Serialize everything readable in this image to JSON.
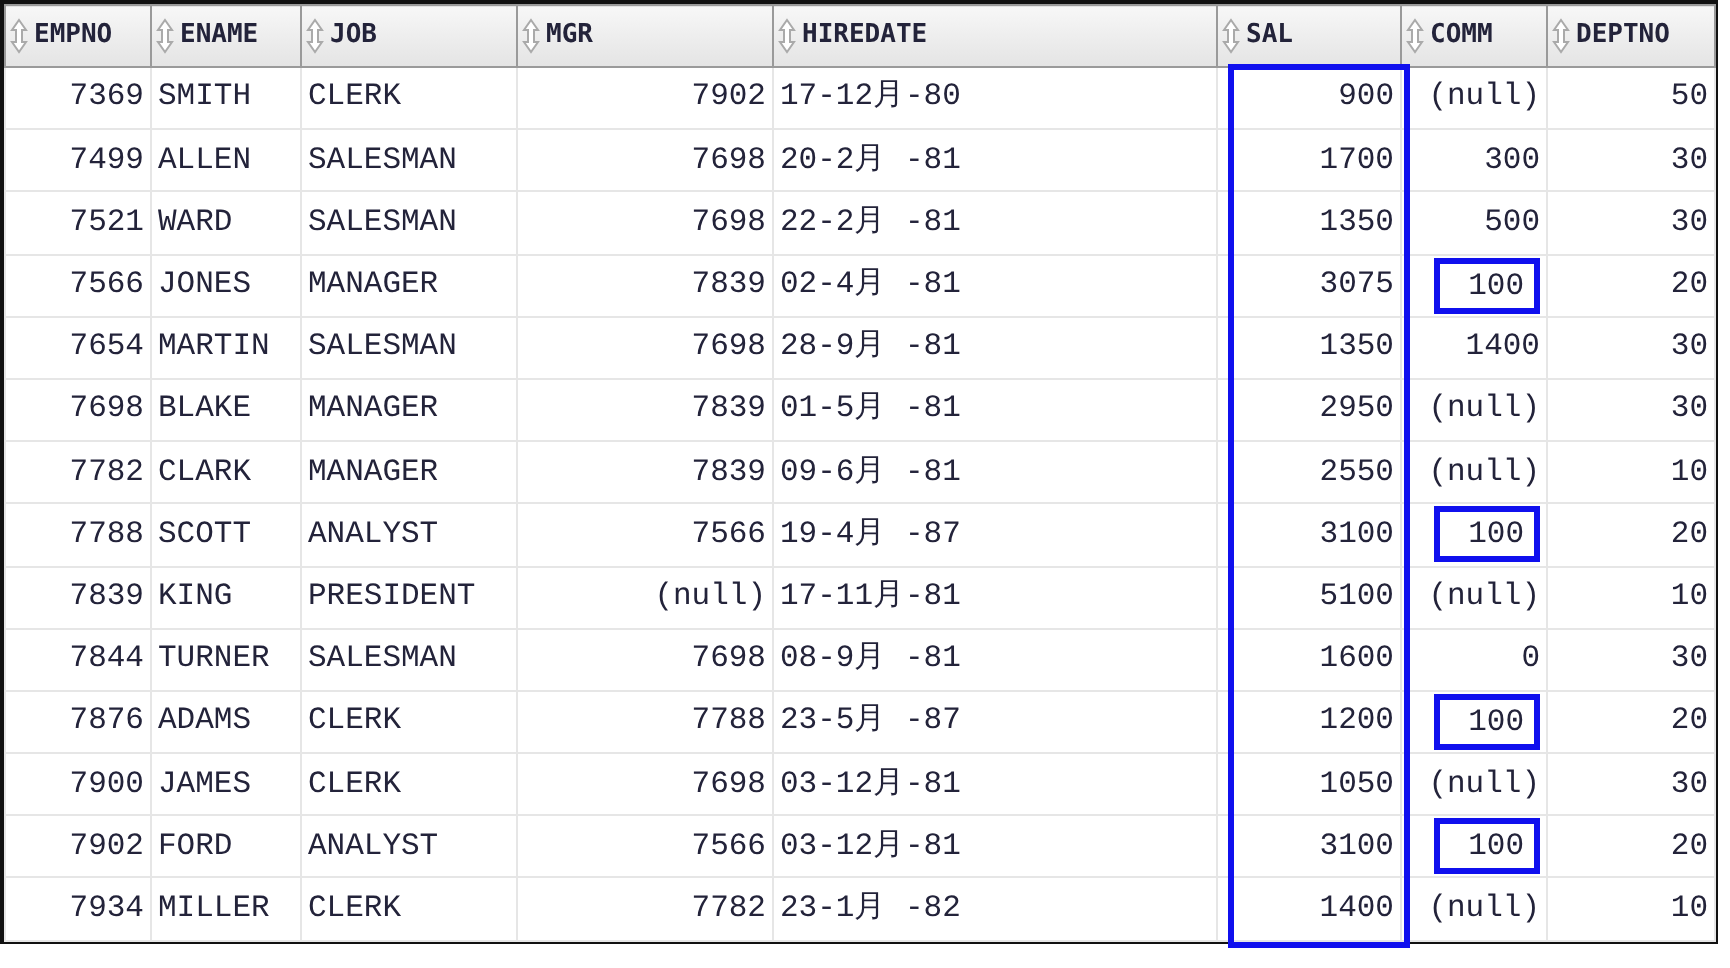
{
  "columns": [
    {
      "label": "EMPNO",
      "kind": "number",
      "outlined": false
    },
    {
      "label": "ENAME",
      "kind": "text",
      "outlined": false
    },
    {
      "label": "JOB",
      "kind": "text",
      "outlined": false
    },
    {
      "label": "MGR",
      "kind": "number",
      "outlined": false
    },
    {
      "label": "HIREDATE",
      "kind": "date",
      "outlined": false
    },
    {
      "label": "SAL",
      "kind": "number",
      "outlined": true
    },
    {
      "label": "COMM",
      "kind": "number",
      "outlined": false
    },
    {
      "label": "DEPTNO",
      "kind": "number",
      "outlined": false
    }
  ],
  "rows": [
    {
      "cells": [
        "7369",
        "SMITH",
        "CLERK",
        "7902",
        "17-12月-80",
        "900",
        "(null)",
        "50"
      ],
      "comm_outlined": false
    },
    {
      "cells": [
        "7499",
        "ALLEN",
        "SALESMAN",
        "7698",
        "20-2月 -81",
        "1700",
        "300",
        "30"
      ],
      "comm_outlined": false
    },
    {
      "cells": [
        "7521",
        "WARD",
        "SALESMAN",
        "7698",
        "22-2月 -81",
        "1350",
        "500",
        "30"
      ],
      "comm_outlined": false
    },
    {
      "cells": [
        "7566",
        "JONES",
        "MANAGER",
        "7839",
        "02-4月 -81",
        "3075",
        "100",
        "20"
      ],
      "comm_outlined": true
    },
    {
      "cells": [
        "7654",
        "MARTIN",
        "SALESMAN",
        "7698",
        "28-9月 -81",
        "1350",
        "1400",
        "30"
      ],
      "comm_outlined": false
    },
    {
      "cells": [
        "7698",
        "BLAKE",
        "MANAGER",
        "7839",
        "01-5月 -81",
        "2950",
        "(null)",
        "30"
      ],
      "comm_outlined": false
    },
    {
      "cells": [
        "7782",
        "CLARK",
        "MANAGER",
        "7839",
        "09-6月 -81",
        "2550",
        "(null)",
        "10"
      ],
      "comm_outlined": false
    },
    {
      "cells": [
        "7788",
        "SCOTT",
        "ANALYST",
        "7566",
        "19-4月 -87",
        "3100",
        "100",
        "20"
      ],
      "comm_outlined": true
    },
    {
      "cells": [
        "7839",
        "KING",
        "PRESIDENT",
        "(null)",
        "17-11月-81",
        "5100",
        "(null)",
        "10"
      ],
      "comm_outlined": false
    },
    {
      "cells": [
        "7844",
        "TURNER",
        "SALESMAN",
        "7698",
        "08-9月 -81",
        "1600",
        "0",
        "30"
      ],
      "comm_outlined": false
    },
    {
      "cells": [
        "7876",
        "ADAMS",
        "CLERK",
        "7788",
        "23-5月 -87",
        "1200",
        "100",
        "20"
      ],
      "comm_outlined": true
    },
    {
      "cells": [
        "7900",
        "JAMES",
        "CLERK",
        "7698",
        "03-12月-81",
        "1050",
        "(null)",
        "30"
      ],
      "comm_outlined": false
    },
    {
      "cells": [
        "7902",
        "FORD",
        "ANALYST",
        "7566",
        "03-12月-81",
        "3100",
        "100",
        "20"
      ],
      "comm_outlined": true
    },
    {
      "cells": [
        "7934",
        "MILLER",
        "CLERK",
        "7782",
        "23-1月 -82",
        "1400",
        "(null)",
        "10"
      ],
      "comm_outlined": false
    }
  ]
}
